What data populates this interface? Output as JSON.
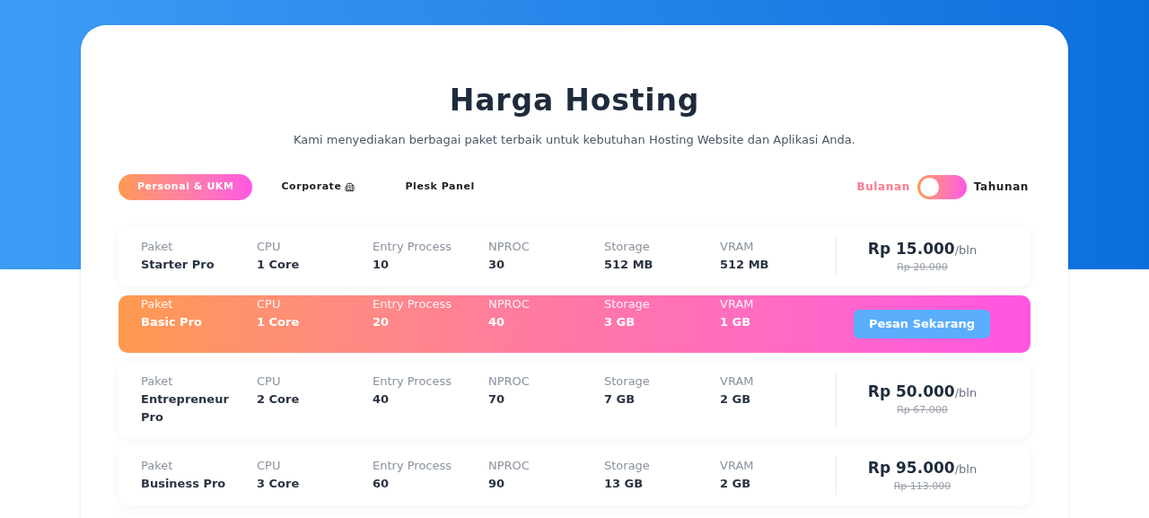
{
  "title": "Harga Hosting",
  "subtitle": "Kami menyediakan berbagai paket terbaik untuk kebutuhan Hosting Website dan Aplikasi Anda.",
  "tabs": [
    {
      "label": "Personal & UKM",
      "selected": true,
      "icon": false
    },
    {
      "label": "Corporate",
      "selected": false,
      "icon": true
    },
    {
      "label": "Plesk Panel",
      "selected": false,
      "icon": false
    }
  ],
  "billing": [
    {
      "label": "Bulanan",
      "selected": true
    },
    {
      "label": "Tahunan",
      "selected": false
    }
  ],
  "plans": [
    {
      "selected": false,
      "cells": [
        {
          "label": "Paket",
          "value": "Starter Pro"
        },
        {
          "label": "CPU",
          "value": "1 Core"
        },
        {
          "label": "Entry Process",
          "value": "10"
        },
        {
          "label": "NPROC",
          "value": "30"
        },
        {
          "label": "Storage",
          "value": "512 MB"
        },
        {
          "label": "VRAM",
          "value": "512 MB"
        }
      ],
      "price": "Rp 15.000",
      "unit": "/bln",
      "old_price": "Rp 20.000"
    },
    {
      "selected": true,
      "cells": [
        {
          "label": "Paket",
          "value": "Basic Pro"
        },
        {
          "label": "CPU",
          "value": "1 Core"
        },
        {
          "label": "Entry Process",
          "value": "20"
        },
        {
          "label": "NPROC",
          "value": "40"
        },
        {
          "label": "Storage",
          "value": "3 GB"
        },
        {
          "label": "VRAM",
          "value": "1 GB"
        }
      ],
      "action": "Pesan Sekarang"
    },
    {
      "selected": false,
      "cells": [
        {
          "label": "Paket",
          "value": "Entrepreneur Pro"
        },
        {
          "label": "CPU",
          "value": "2 Core"
        },
        {
          "label": "Entry Process",
          "value": "40"
        },
        {
          "label": "NPROC",
          "value": "70"
        },
        {
          "label": "Storage",
          "value": "7 GB"
        },
        {
          "label": "VRAM",
          "value": "2 GB"
        }
      ],
      "price": "Rp 50.000",
      "unit": "/bln",
      "old_price": "Rp 67.000"
    },
    {
      "selected": false,
      "cells": [
        {
          "label": "Paket",
          "value": "Business Pro"
        },
        {
          "label": "CPU",
          "value": "3 Core"
        },
        {
          "label": "Entry Process",
          "value": "60"
        },
        {
          "label": "NPROC",
          "value": "90"
        },
        {
          "label": "Storage",
          "value": "13 GB"
        },
        {
          "label": "VRAM",
          "value": "2 GB"
        }
      ],
      "price": "Rp 95.000",
      "unit": "/bln",
      "old_price": "Rp 113.000"
    }
  ]
}
